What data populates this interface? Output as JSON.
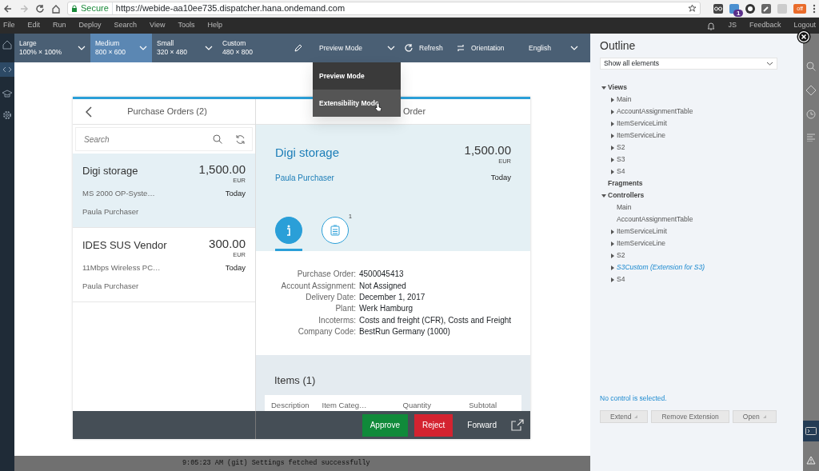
{
  "browser": {
    "secure_label": "Secure",
    "url": "https://webide-aa10ee735.dispatcher.hana.ondemand.com",
    "extension_badge": "1",
    "extension_off": "off"
  },
  "menu": [
    "File",
    "Edit",
    "Run",
    "Deploy",
    "Search",
    "View",
    "Tools",
    "Help"
  ],
  "user": {
    "initials": "JS"
  },
  "header_links": [
    "Feedback",
    "Logout"
  ],
  "devices": [
    {
      "label": "Large",
      "size": "100% × 100%",
      "selected": false,
      "caret": true
    },
    {
      "label": "Medium",
      "size": "800 × 600",
      "selected": true,
      "caret": true
    },
    {
      "label": "Small",
      "size": "320 × 480",
      "selected": false,
      "caret": true
    },
    {
      "label": "Custom",
      "size": "480 × 800",
      "selected": false,
      "caret": false
    }
  ],
  "toolbar": {
    "mode": "Preview Mode",
    "refresh": "Refresh",
    "orientation": "Orientation",
    "language": "English"
  },
  "mode_menu": [
    {
      "label": "Preview Mode",
      "hovered": false
    },
    {
      "label": "Extensibility Mode",
      "hovered": true
    }
  ],
  "app": {
    "master": {
      "title": "Purchase Orders (2)",
      "search_placeholder": "Search",
      "items": [
        {
          "name": "Digi storage",
          "amount": "1,500.00",
          "currency": "EUR",
          "description": "MS 2000 OP-Syste…",
          "date": "Today",
          "requester": "Paula Purchaser",
          "selected": true
        },
        {
          "name": "IDES SUS Vendor",
          "amount": "300.00",
          "currency": "EUR",
          "description": "11Mbps Wireless PC…",
          "date": "Today",
          "requester": "Paula Purchaser",
          "selected": false
        }
      ]
    },
    "detail": {
      "title": "Order",
      "name": "Digi storage",
      "amount": "1,500.00",
      "currency": "EUR",
      "requester": "Paula Purchaser",
      "date": "Today",
      "tabs": [
        {
          "kind": "info",
          "selected": true
        },
        {
          "kind": "notes",
          "count": "1",
          "selected": false
        }
      ],
      "fields": [
        {
          "label": "Purchase Order:",
          "value": "4500045413"
        },
        {
          "label": "Account Assignment:",
          "value": "Not Assigned"
        },
        {
          "label": "Delivery Date:",
          "value": "December 1, 2017"
        },
        {
          "label": "Plant:",
          "value": "Werk Hamburg"
        },
        {
          "label": "Incoterms:",
          "value": "Costs and freight (CFR), Costs and Freight"
        },
        {
          "label": "Company Code:",
          "value": "BestRun Germany (1000)"
        }
      ],
      "items_title": "Items (1)",
      "columns": [
        "Description",
        "Item Categ…",
        "Quantity",
        "Subtotal"
      ]
    },
    "footer_buttons": [
      {
        "label": "Approve",
        "kind": "accept"
      },
      {
        "label": "Reject",
        "kind": "reject"
      },
      {
        "label": "Forward",
        "kind": "plain"
      }
    ]
  },
  "outline": {
    "title": "Outline",
    "filter": "Show all elements",
    "tree": [
      {
        "label": "Views",
        "expanded": true,
        "children": [
          {
            "label": "Main",
            "expanded": false,
            "extension": false
          },
          {
            "label": "AccountAssignmentTable",
            "expanded": false,
            "extension": false
          },
          {
            "label": "ItemServiceLimit",
            "expanded": false,
            "extension": false
          },
          {
            "label": "ItemServiceLine",
            "expanded": false,
            "extension": false
          },
          {
            "label": "S2",
            "expanded": false,
            "extension": false
          },
          {
            "label": "S3",
            "expanded": false,
            "extension": false
          },
          {
            "label": "S4",
            "expanded": false,
            "extension": false
          }
        ]
      },
      {
        "label": "Fragments"
      },
      {
        "label": "Controllers",
        "expanded": true,
        "children": [
          {
            "label": "Main",
            "extension": false
          },
          {
            "label": "AccountAssignmentTable",
            "extension": false
          },
          {
            "label": "ItemServiceLimit",
            "expanded": false,
            "extension": false
          },
          {
            "label": "ItemServiceLine",
            "expanded": false,
            "extension": false
          },
          {
            "label": "S2",
            "expanded": false,
            "extension": false
          },
          {
            "label": "S3Custom (Extension for S3)",
            "expanded": false,
            "extension": true
          },
          {
            "label": "S4",
            "expanded": false,
            "extension": false
          }
        ]
      }
    ],
    "message": "No control is selected.",
    "buttons": [
      {
        "label": "Extend",
        "disabled": true,
        "caret": true
      },
      {
        "label": "Remove Extension",
        "disabled": true,
        "caret": false
      },
      {
        "label": "Open",
        "disabled": true,
        "caret": true
      }
    ]
  },
  "console": "9:05:23 AM (git) Settings fetched successfully"
}
